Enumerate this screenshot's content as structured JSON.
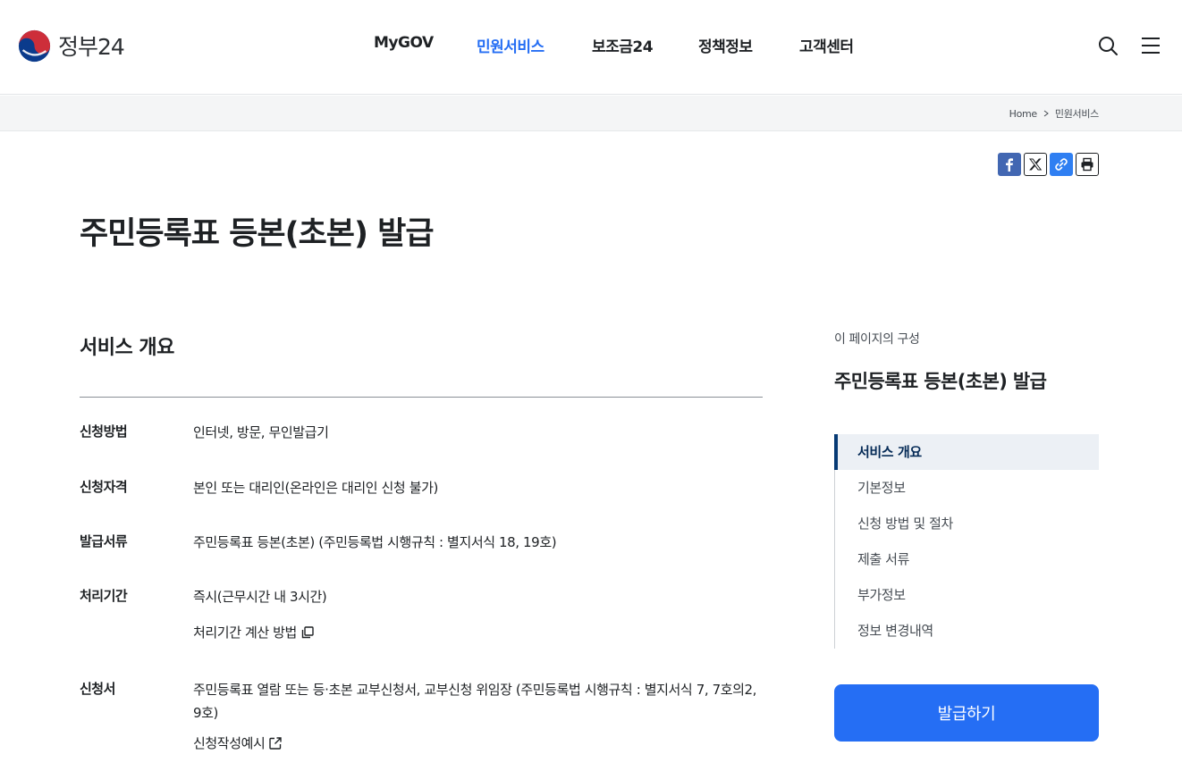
{
  "header": {
    "logo_text": "정부24",
    "nav": [
      "MyGOV",
      "민원서비스",
      "보조금24",
      "정책정보",
      "고객센터"
    ],
    "active_nav": "민원서비스",
    "search_icon": "search-icon",
    "menu_icon": "hamburger-menu-icon"
  },
  "breadcrumb": {
    "home": "Home",
    "current": "민원서비스"
  },
  "share": {
    "icons": [
      "facebook-icon",
      "x-icon",
      "link-icon",
      "print-icon"
    ]
  },
  "page": {
    "title": "주민등록표 등본(초본) 발급"
  },
  "overview": {
    "section_title": "서비스 개요",
    "rows": [
      {
        "label": "신청방법",
        "value": "인터넷, 방문, 무인발급기"
      },
      {
        "label": "신청자격",
        "value": "본인 또는 대리인(온라인은 대리인 신청 불가)"
      },
      {
        "label": "발급서류",
        "value": "주민등록표 등본(초본) (주민등록법 시행규칙 : 별지서식 18, 19호)"
      },
      {
        "label": "처리기간",
        "value": "즉시(근무시간 내 3시간)",
        "link": "처리기간 계산 방법"
      },
      {
        "label": "신청서",
        "value": "주민등록표 열람 또는 등·초본 교부신청서, 교부신청 위임장 (주민등록법 시행규칙 : 별지서식 7, 7호의2, 9호)",
        "link": "신청작성예시"
      }
    ]
  },
  "sidebar": {
    "caption": "이 페이지의 구성",
    "title": "주민등록표 등본(초본) 발급",
    "items": [
      "서비스 개요",
      "기본정보",
      "신청 방법 및 절차",
      "제출 서류",
      "부가정보",
      "정보 변경내역"
    ],
    "active_item": "서비스 개요",
    "apply_button": "발급하기"
  },
  "colors": {
    "accent": "#256ef4",
    "nav_active": "#256ef4",
    "toc_active_bar": "#063a74",
    "toc_active_bg": "#ecf0f5",
    "facebook": "#4267b2"
  }
}
